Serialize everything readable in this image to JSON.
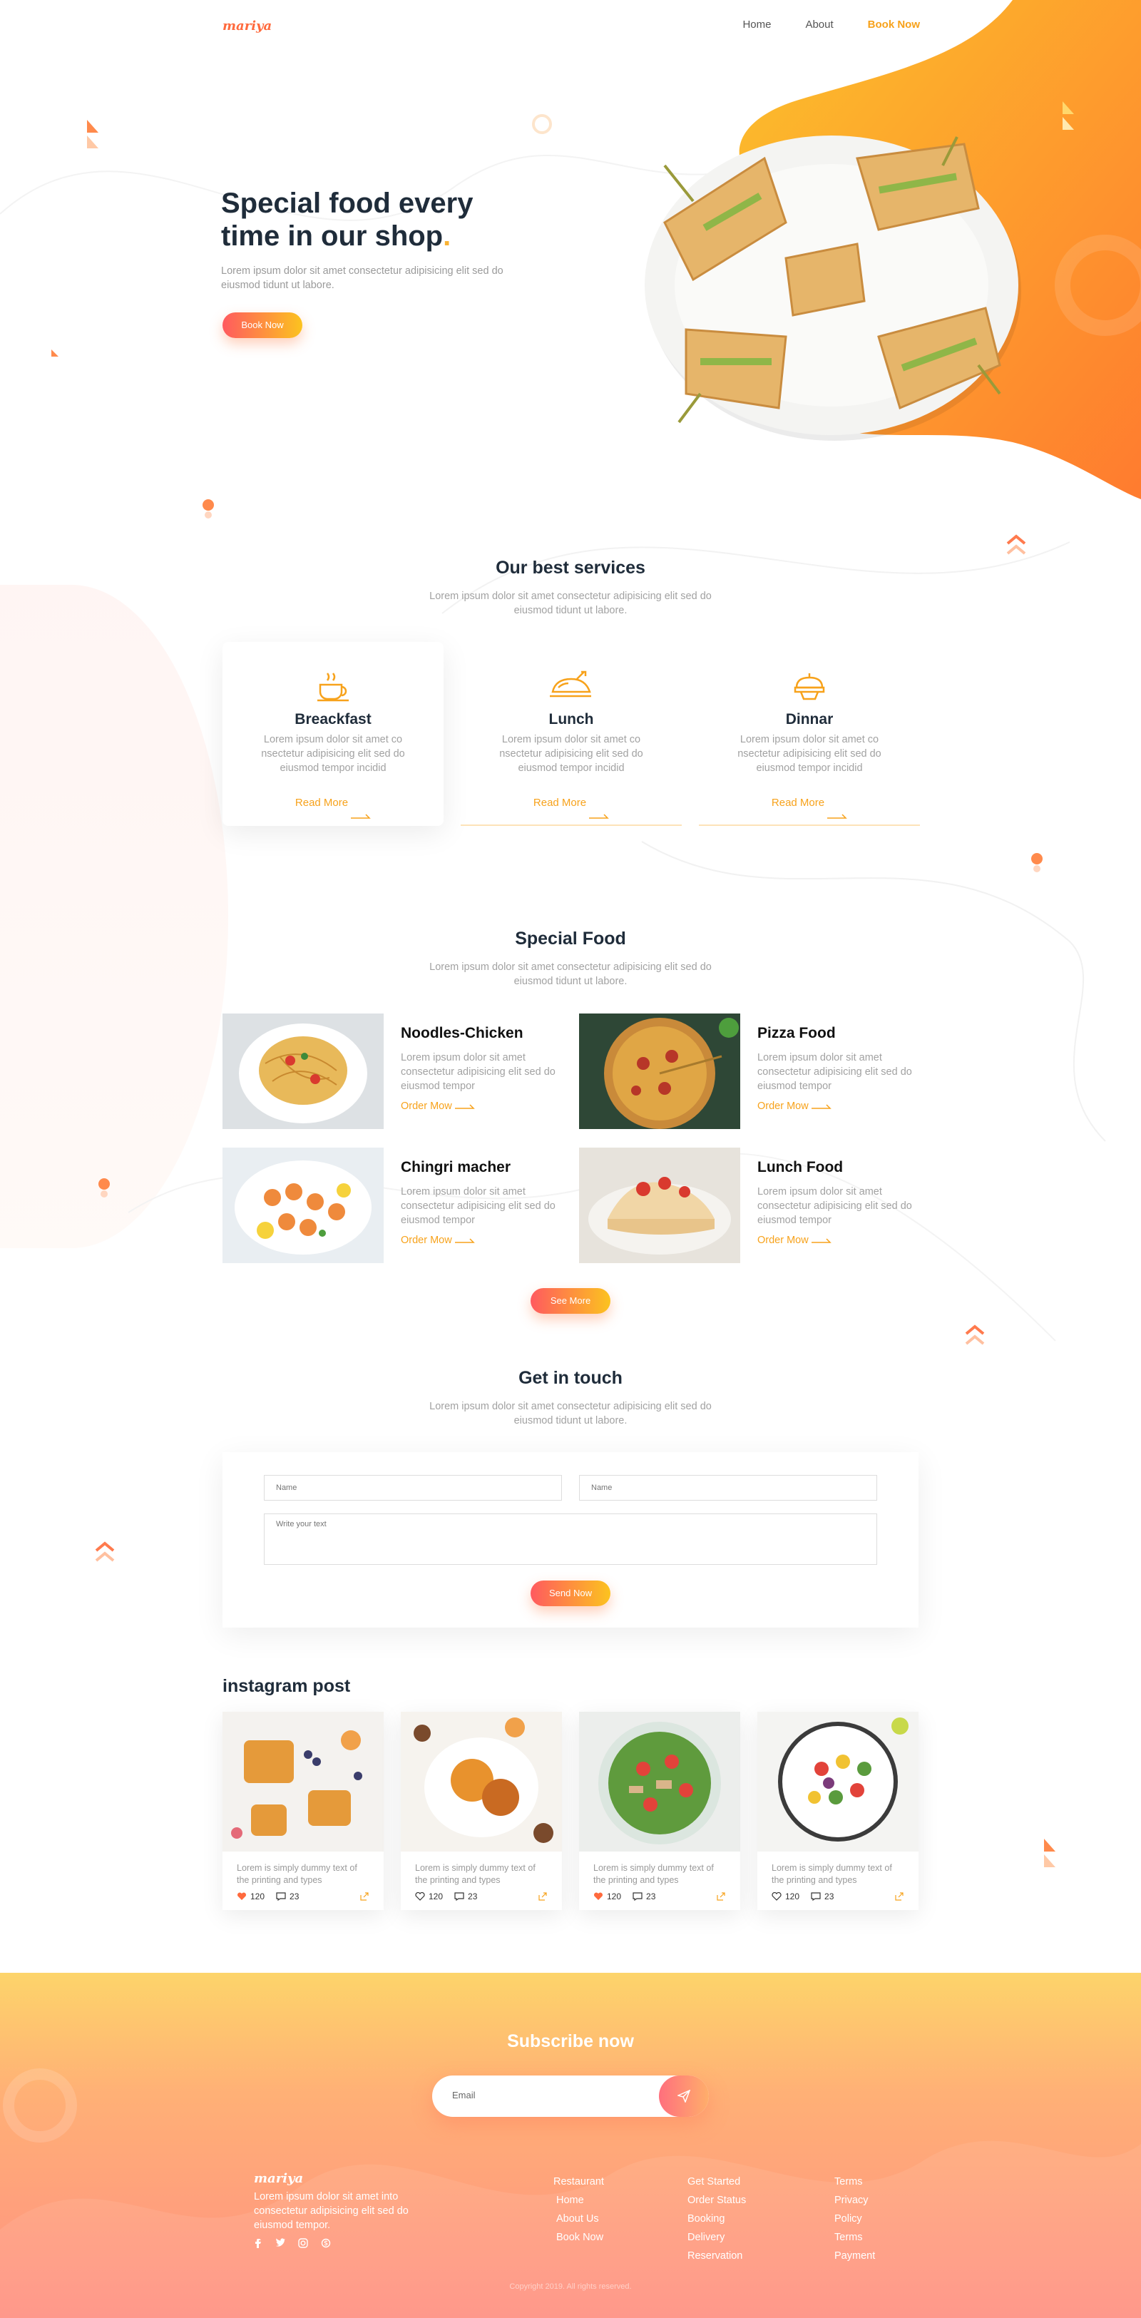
{
  "brand": {
    "logo": "mariya",
    "accent": "#f7a21b",
    "gradient_start": "#ff5a5f",
    "gradient_end": "#fcc31f"
  },
  "nav": {
    "items": [
      {
        "label": "Home"
      },
      {
        "label": "About"
      },
      {
        "label": "Book Now"
      }
    ]
  },
  "hero": {
    "title": "Special food every time in our shop",
    "title_dot": ".",
    "text": "Lorem ipsum dolor sit amet consectetur adipisicing elit sed do eiusmod tidunt ut labore.",
    "button": "Book Now",
    "image_icon": "sandwich-plate-image"
  },
  "services": {
    "title": "Our best services",
    "subtitle": "Lorem ipsum dolor sit amet consectetur adipisicing elit sed do eiusmod tidunt ut labore.",
    "items": [
      {
        "title": "Breackfast",
        "icon": "coffee-cup-icon",
        "text": "Lorem ipsum dolor sit amet co nsectetur adipisicing elit sed do eiusmod tempor incidid",
        "link": "Read More"
      },
      {
        "title": "Lunch",
        "icon": "roast-chicken-icon",
        "text": "Lorem ipsum dolor sit amet co nsectetur adipisicing elit sed do eiusmod tempor incidid",
        "link": "Read More"
      },
      {
        "title": "Dinnar",
        "icon": "cake-icon",
        "text": "Lorem ipsum dolor sit amet co nsectetur adipisicing elit sed do eiusmod tempor incidid",
        "link": "Read More"
      }
    ]
  },
  "special": {
    "title": "Special Food",
    "subtitle": "Lorem ipsum dolor sit amet consectetur adipisicing elit sed do eiusmod tidunt ut labore.",
    "items": [
      {
        "title": "Noodles-Chicken",
        "text": "Lorem ipsum dolor sit amet consectetur adipisicing elit sed do eiusmod tempor",
        "link": "Order Mow"
      },
      {
        "title": "Pizza Food",
        "text": "Lorem ipsum dolor sit amet consectetur adipisicing elit sed do eiusmod tempor",
        "link": "Order Mow"
      },
      {
        "title": "Chingri macher",
        "text": "Lorem ipsum dolor sit amet consectetur adipisicing elit sed do eiusmod tempor",
        "link": "Order Mow"
      },
      {
        "title": "Lunch Food",
        "text": "Lorem ipsum dolor sit amet consectetur adipisicing elit sed do eiusmod tempor",
        "link": "Order Mow"
      }
    ],
    "button": "See More"
  },
  "contact": {
    "title": "Get in touch",
    "subtitle": "Lorem ipsum dolor sit amet consectetur adipisicing elit sed do eiusmod tidunt ut labore.",
    "name1_placeholder": "Name",
    "name2_placeholder": "Name",
    "message_placeholder": "Write your text",
    "button": "Send Now"
  },
  "instagram": {
    "title": "instagram post",
    "posts": [
      {
        "text": "Lorem is simply dummy text of the printing and types",
        "likes": "120",
        "comments": "23",
        "liked": true
      },
      {
        "text": "Lorem is simply dummy text of the printing and types",
        "likes": "120",
        "comments": "23",
        "liked": false
      },
      {
        "text": "Lorem is simply dummy text of the printing and types",
        "likes": "120",
        "comments": "23",
        "liked": true
      },
      {
        "text": "Lorem is simply dummy text of the printing and types",
        "likes": "120",
        "comments": "23",
        "liked": false
      }
    ]
  },
  "footer": {
    "subscribe_title": "Subscribe now",
    "email_placeholder": "Email",
    "logo": "mariya",
    "about": "Lorem ipsum dolor sit amet into consectetur adipisicing elit sed do eiusmod tempor.",
    "social_icons": [
      "facebook-icon",
      "twitter-icon",
      "instagram-icon",
      "skype-icon"
    ],
    "col1": [
      "Restaurant",
      "Home",
      "About Us",
      "Book Now"
    ],
    "col2": [
      "Get Started",
      "Order Status",
      "Booking",
      "Delivery",
      "Reservation"
    ],
    "col3": [
      "Terms",
      "Privacy",
      "Policy",
      "Terms",
      "Payment"
    ],
    "copyright": "Copyright 2019. All rights reserved."
  }
}
